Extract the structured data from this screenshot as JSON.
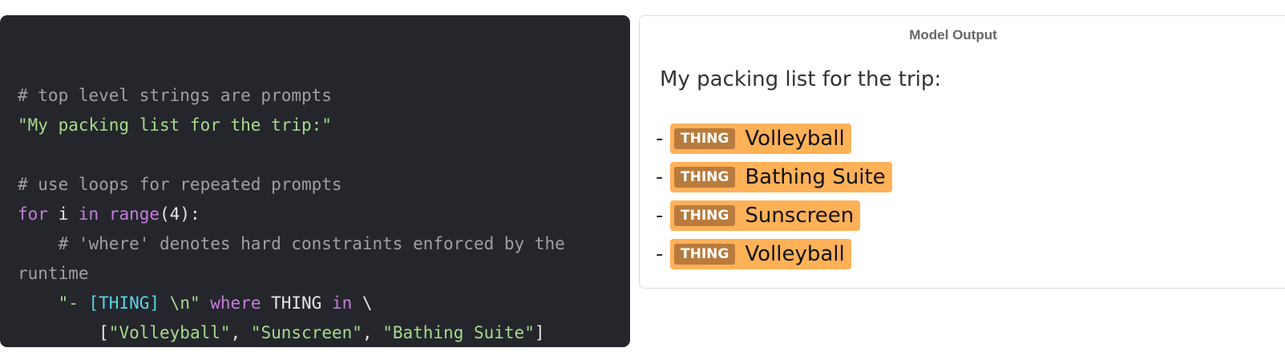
{
  "code": {
    "line1": "# top level strings are prompts",
    "line2": "\"My packing list for the trip:\"",
    "line4": "# use loops for repeated prompts",
    "line5_for": "for",
    "line5_i": " i ",
    "line5_in": "in",
    "line5_range": " range",
    "line5_rest": "(4):",
    "line6": "    # 'where' denotes hard constraints enforced by the",
    "line7": "runtime",
    "line8_indent": "    ",
    "line8_q1": "\"- ",
    "line8_var": "[THING]",
    "line8_q2": " \\n\"",
    "line8_where": " where",
    "line8_thing": " THING ",
    "line8_in": "in",
    "line8_bs": " \\",
    "line9_open": "        [",
    "line9_s1": "\"Volleyball\"",
    "line9_c1": ", ",
    "line9_s2": "\"Sunscreen\"",
    "line9_c2": ", ",
    "line9_s3": "\"Bathing Suite\"",
    "line9_close": "]"
  },
  "output": {
    "title": "Model Output",
    "prompt": "My packing list for the trip:",
    "dash": "-",
    "items": [
      {
        "label": "THING",
        "value": "Volleyball"
      },
      {
        "label": "THING",
        "value": "Bathing Suite"
      },
      {
        "label": "THING",
        "value": "Sunscreen"
      },
      {
        "label": "THING",
        "value": "Volleyball"
      }
    ],
    "chip_color": "#ffb158",
    "label_color": "#b97b3d"
  }
}
